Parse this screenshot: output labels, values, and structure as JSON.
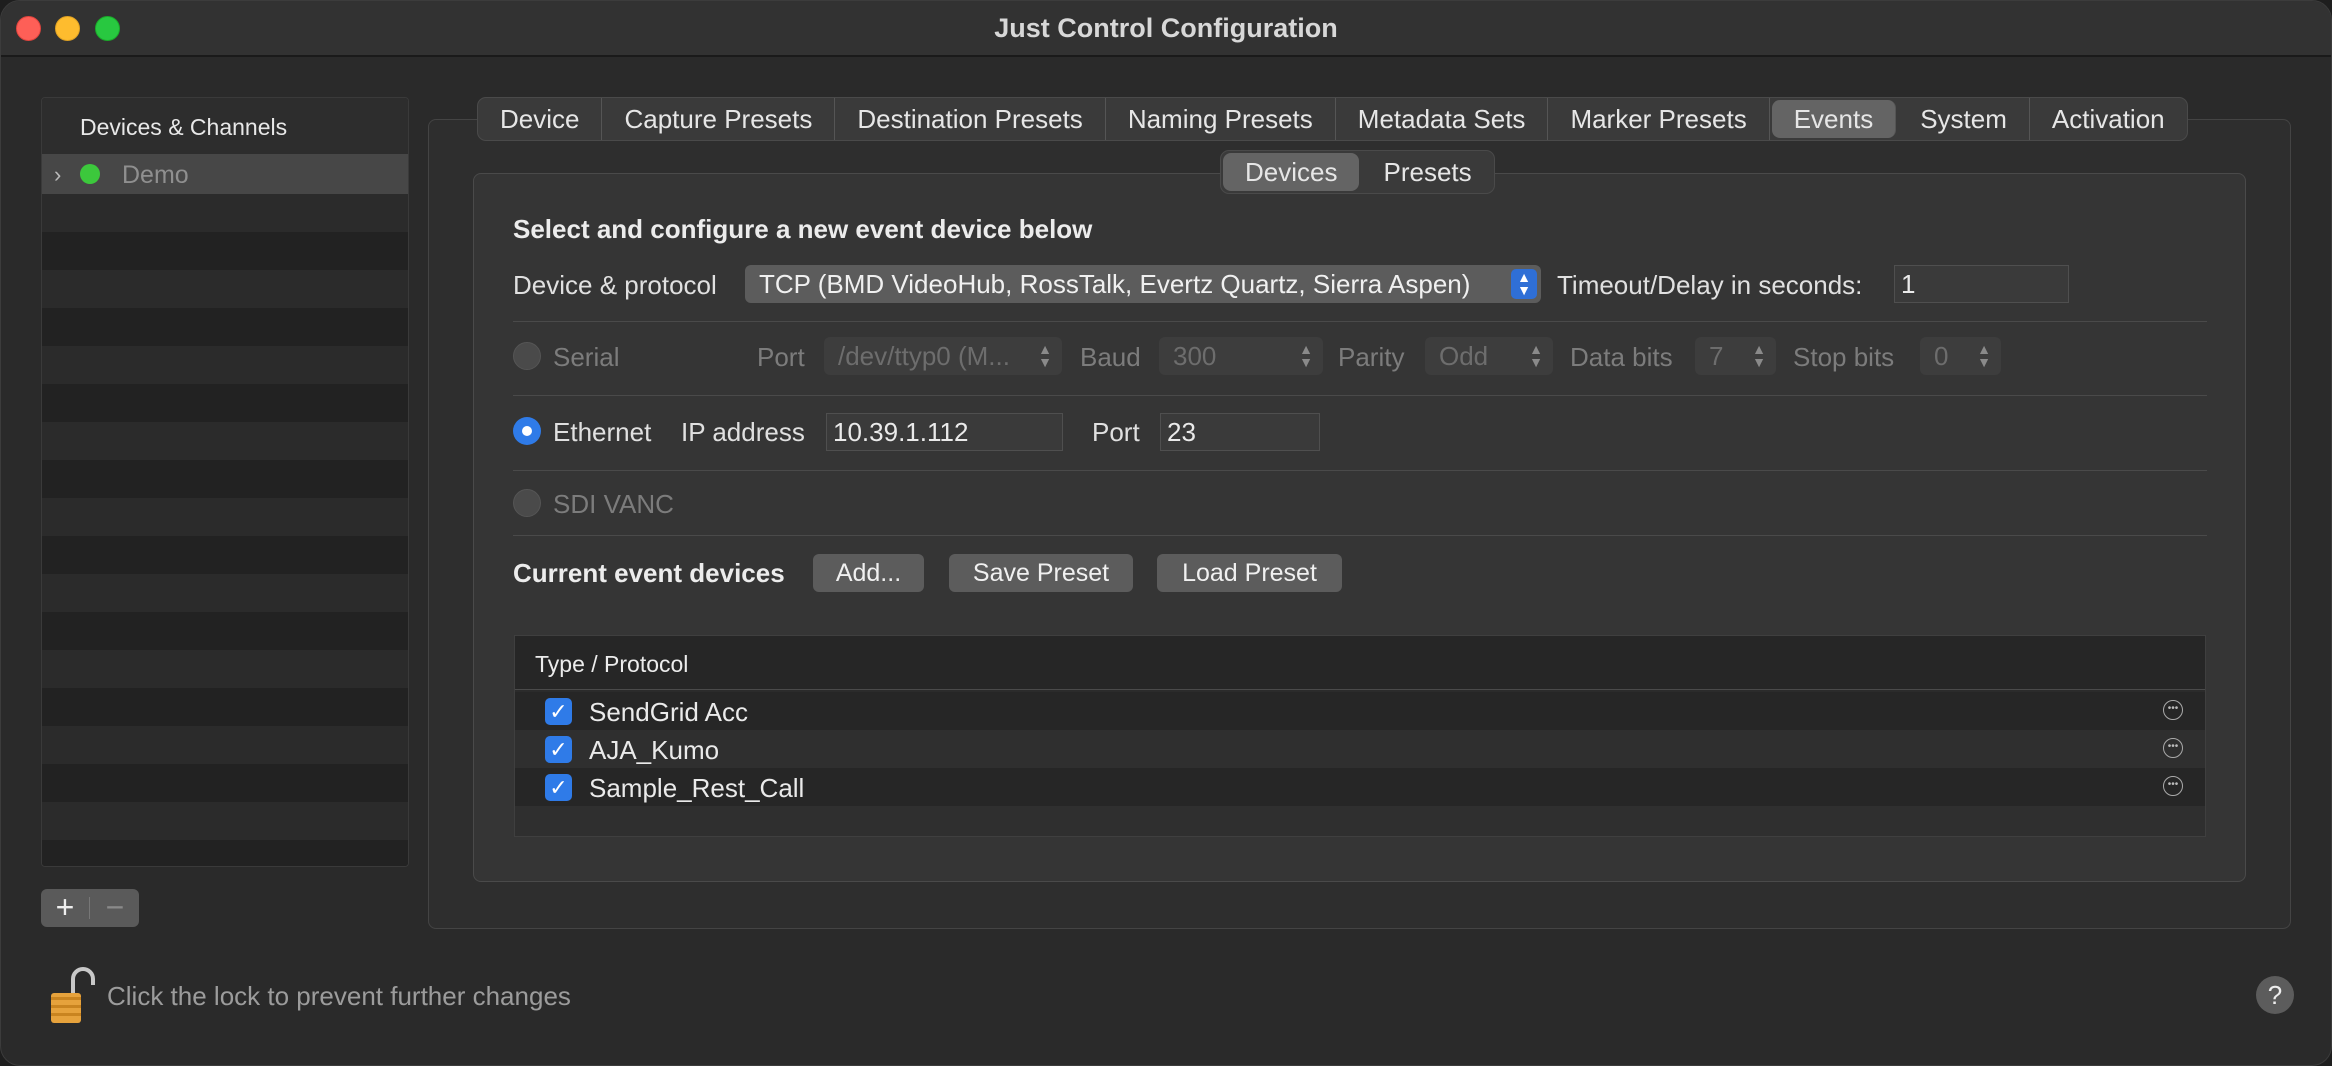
{
  "window": {
    "title": "Just Control Configuration"
  },
  "sidebar": {
    "header": "Devices & Channels",
    "items": [
      {
        "label": "Demo",
        "status_color": "#3cc83c"
      }
    ],
    "add_label": "+",
    "remove_label": "−"
  },
  "tabs": [
    "Device",
    "Capture Presets",
    "Destination Presets",
    "Naming Presets",
    "Metadata Sets",
    "Marker Presets",
    "Events",
    "System",
    "Activation"
  ],
  "active_tab": "Events",
  "subtabs": [
    "Devices",
    "Presets"
  ],
  "active_subtab": "Devices",
  "config": {
    "heading": "Select and configure a new event device below",
    "device_protocol_label": "Device & protocol",
    "device_protocol_value": "TCP (BMD VideoHub, RossTalk, Evertz Quartz, Sierra Aspen)",
    "timeout_label": "Timeout/Delay in seconds:",
    "timeout_value": "1",
    "serial": {
      "label": "Serial",
      "port_label": "Port",
      "port_value": "/dev/ttyp0 (M...",
      "baud_label": "Baud",
      "baud_value": "300",
      "parity_label": "Parity",
      "parity_value": "Odd",
      "databits_label": "Data bits",
      "databits_value": "7",
      "stopbits_label": "Stop bits",
      "stopbits_value": "0"
    },
    "ethernet": {
      "label": "Ethernet",
      "ip_label": "IP address",
      "ip_value": "10.39.1.112",
      "port_label": "Port",
      "port_value": "23"
    },
    "sdi": {
      "label": "SDI VANC"
    }
  },
  "current": {
    "label": "Current event devices",
    "add_button": "Add...",
    "save_button": "Save Preset",
    "load_button": "Load Preset"
  },
  "table": {
    "header": "Type / Protocol",
    "rows": [
      {
        "name": "SendGrid Acc",
        "checked": true
      },
      {
        "name": "AJA_Kumo",
        "checked": true
      },
      {
        "name": "Sample_Rest_Call",
        "checked": true
      }
    ]
  },
  "footer": {
    "lock_text": "Click the lock to prevent further changes",
    "help": "?"
  },
  "colors": {
    "accent": "#2f7be8",
    "background": "#2a2a2a"
  }
}
